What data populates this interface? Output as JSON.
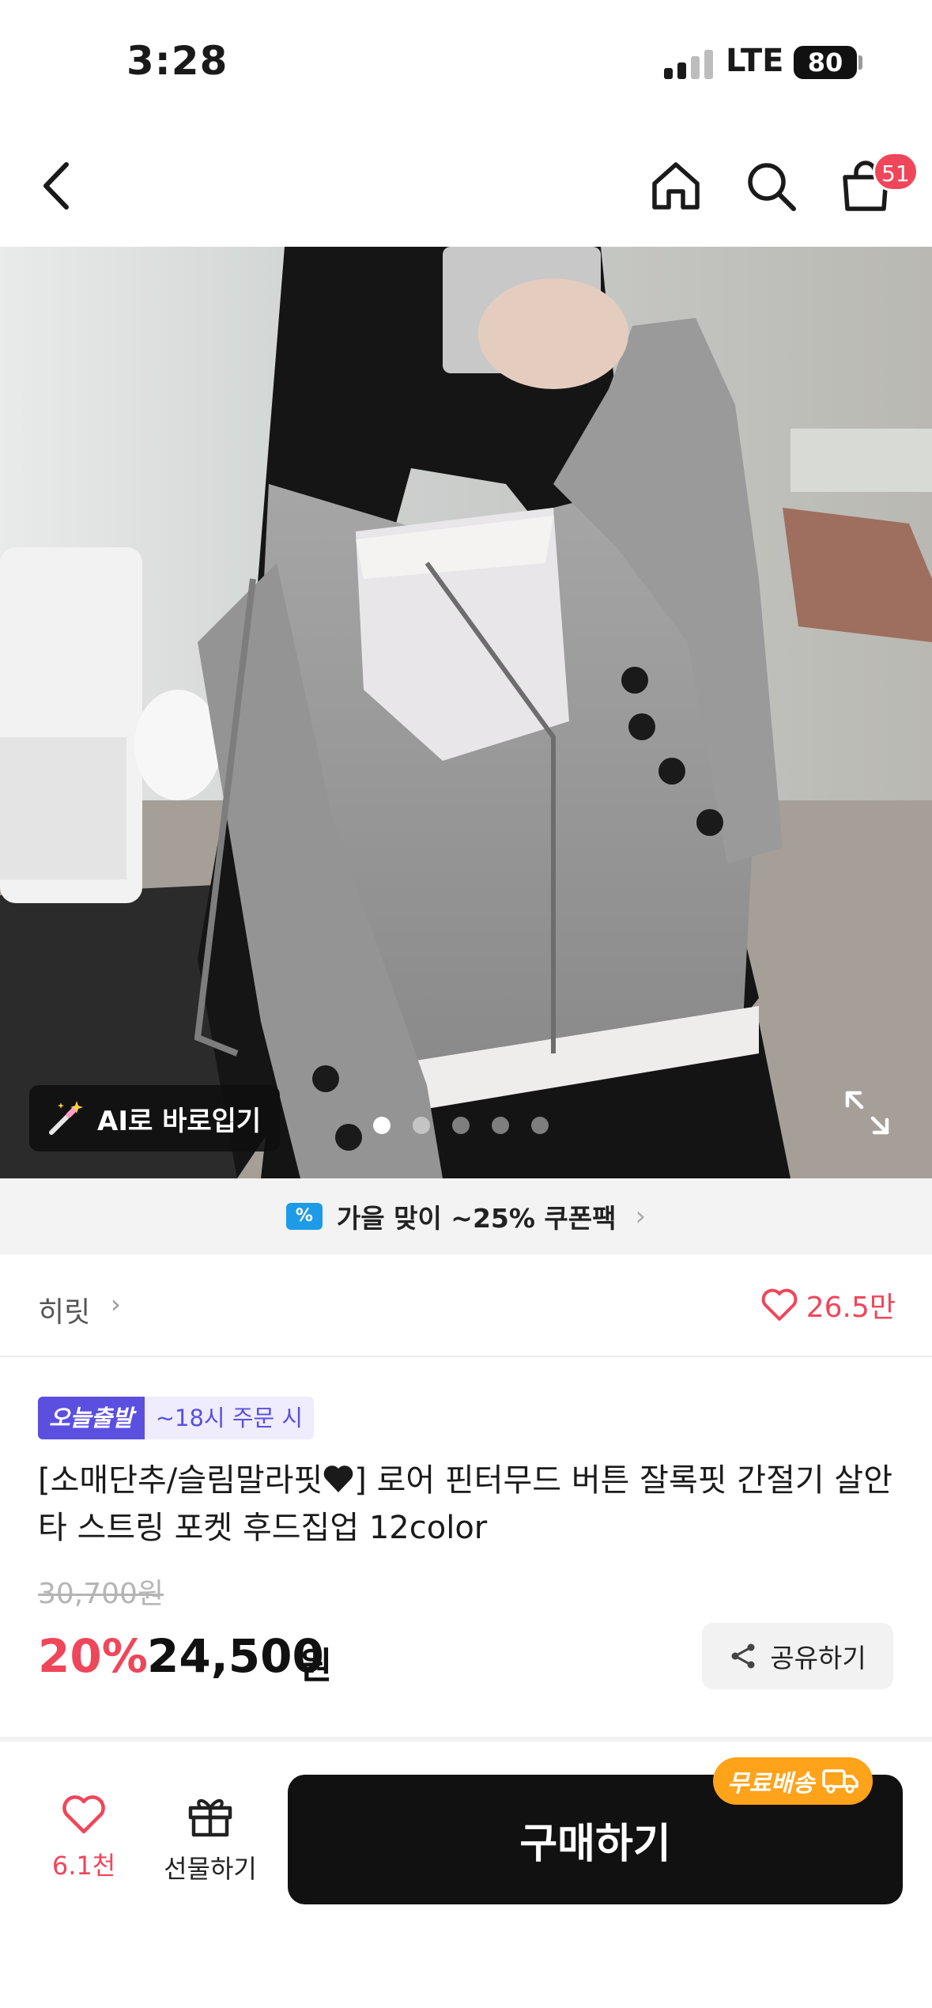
{
  "status_bar": {
    "time": "3:28",
    "network": "LTE",
    "battery": "80"
  },
  "nav": {
    "cart_count": "51"
  },
  "gallery": {
    "ai_button_label": "AI로 바로입기",
    "page_count": 5,
    "active_page": 1
  },
  "coupon": {
    "icon": "%",
    "text": "가을 맞이 ~25% 쿠폰팩"
  },
  "brand": {
    "name": "히릿",
    "like_count": "26.5만"
  },
  "badges": {
    "primary": "오늘출발",
    "secondary": "~18시 주문 시"
  },
  "product": {
    "title_prefix": "[소매단추/슬림말라핏",
    "title_rest": "] 로어 핀터무드 버튼 잘록핏 간절기 살안타 스트링 포켓 후드집업 12color",
    "original_price": "30,700원",
    "discount_rate": "20%",
    "sale_price": "24,500",
    "sale_unit": "원",
    "share_label": "공유하기"
  },
  "bottom_bar": {
    "wish_count": "6.1천",
    "gift_label": "선물하기",
    "buy_label": "구매하기",
    "free_shipping_label": "무료배송"
  },
  "colors": {
    "accent_red": "#f0465a",
    "badge_purple": "#5b4fe0",
    "free_ship_orange": "#ffa31a",
    "coupon_blue": "#1e9be8"
  }
}
